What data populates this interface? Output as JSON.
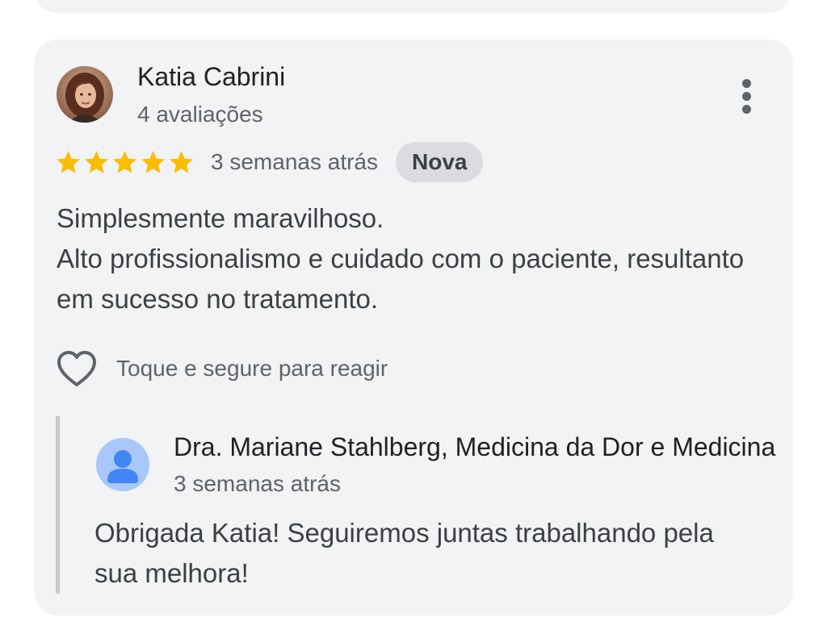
{
  "review": {
    "author": {
      "name": "Katia Cabrini",
      "meta": "4 avaliações",
      "avatar_icon": "user-photo-avatar"
    },
    "rating": 5,
    "rating_max": 5,
    "star_color": "#fbbc04",
    "time": "3 semanas atrás",
    "badge": "Nova",
    "text": "Simplesmente maravilhoso.\nAlto profissionalismo e cuidado com o paciente, resultanto em sucesso no tratamento.",
    "react_label": "Toque e segure para reagir",
    "more_icon": "more-vert-icon",
    "react_icon": "heart-outline-icon"
  },
  "reply": {
    "owner_name": "Dra. Mariane Stahlberg, Medicina da Dor e Medicina",
    "time": "3 semanas atrás",
    "text": "Obrigada Katia! Seguiremos juntas trabalhando pela sua melhora!",
    "avatar_icon": "default-person-avatar"
  },
  "colors": {
    "card_background": "#f1f3f4",
    "avatar_background": "#a8c7fa",
    "avatar_foreground": "#4285f4"
  }
}
